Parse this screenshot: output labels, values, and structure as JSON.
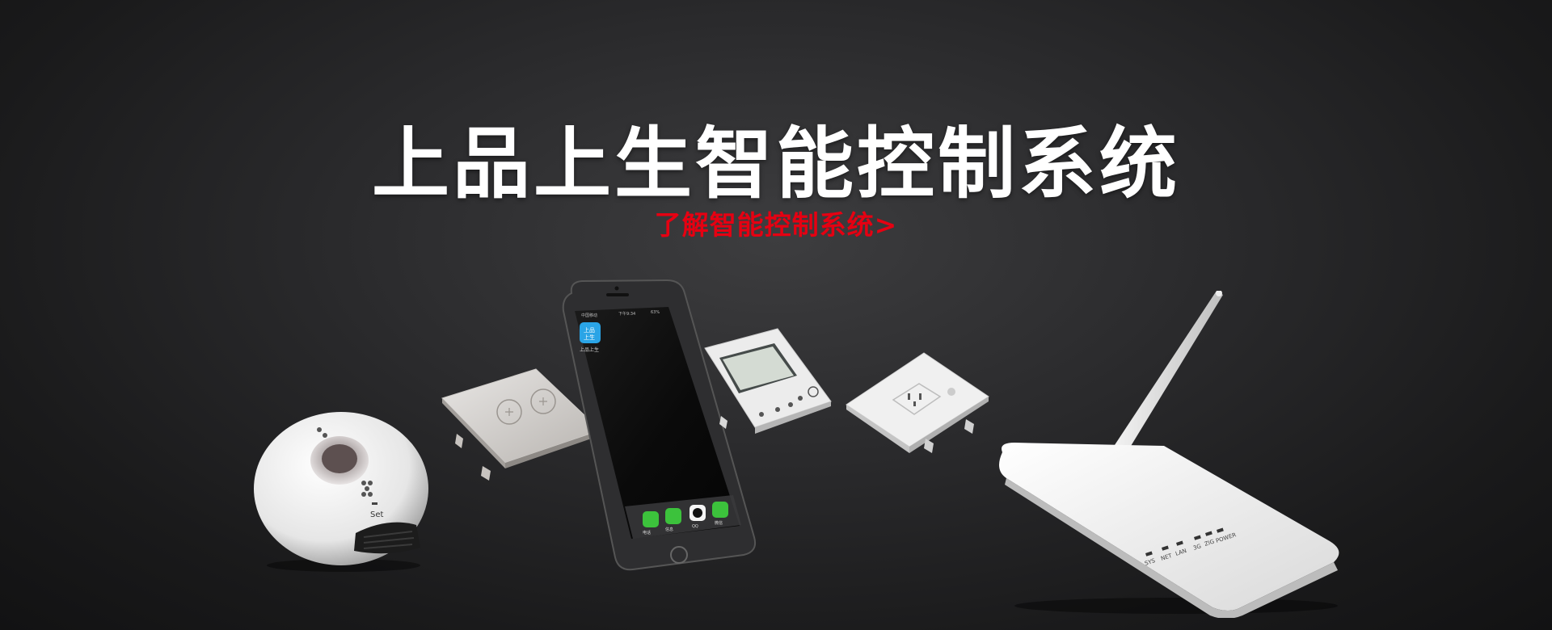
{
  "banner": {
    "title": "上品上生智能控制系统",
    "cta_label": "了解智能控制系统>",
    "accent_color": "#e60012",
    "background_color": "#2a2a2c"
  },
  "products": [
    {
      "name": "smart-speaker",
      "label": "Set"
    },
    {
      "name": "touch-light-switch"
    },
    {
      "name": "smartphone",
      "app_label": "上品上生",
      "app_icon_text": "上品\n上生",
      "carrier": "中国移动",
      "time": "下午9:34",
      "battery": "63%",
      "dock": [
        "电话",
        "信息",
        "QQ",
        "微信"
      ]
    },
    {
      "name": "thermostat-panel"
    },
    {
      "name": "smart-socket"
    },
    {
      "name": "gateway-router",
      "indicators": [
        "SYS",
        "NET",
        "LAN",
        "3G",
        "ZIG",
        "POWER"
      ]
    }
  ]
}
